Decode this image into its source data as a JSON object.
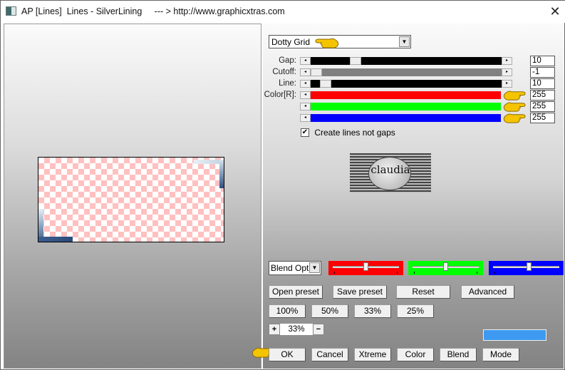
{
  "window": {
    "title": "AP [Lines]  Lines - SilverLining     --- > http://www.graphicxtras.com",
    "close_label": "✕"
  },
  "preset": {
    "selected": "Dotty Grid"
  },
  "sliders": [
    {
      "label": "Gap:",
      "value": "10",
      "position": 0.22,
      "track_color": "#000000"
    },
    {
      "label": "Cutoff:",
      "value": "-1",
      "position": 0.0,
      "track_color": "#808080"
    },
    {
      "label": "Line:",
      "value": "10",
      "position": 0.05,
      "track_color": "#000000"
    },
    {
      "label": "Color[R]:",
      "value": "255",
      "position": 1.0,
      "track_color": "#ff0000"
    },
    {
      "label": "",
      "value": "255",
      "position": 1.0,
      "track_color": "#00ff00"
    },
    {
      "label": "",
      "value": "255",
      "position": 1.0,
      "track_color": "#0000ff"
    }
  ],
  "checkbox": {
    "label": "Create lines not gaps",
    "checked": true
  },
  "logo": {
    "text": "claudia"
  },
  "blend": {
    "selected": "Blend Optio",
    "sliders": [
      {
        "color": "#ff0000",
        "position": 0.5
      },
      {
        "color": "#00ff00",
        "position": 0.5
      },
      {
        "color": "#0000ff",
        "position": 0.55
      }
    ]
  },
  "buttons": {
    "open_preset": "Open preset",
    "save_preset": "Save preset",
    "reset": "Reset",
    "advanced": "Advanced",
    "z100": "100%",
    "z50": "50%",
    "z33": "33%",
    "z25": "25%",
    "ok": "OK",
    "cancel": "Cancel",
    "xtreme": "Xtreme",
    "color": "Color",
    "blend": "Blend",
    "mode": "Mode"
  },
  "zoom": {
    "plus": "+",
    "value": "33%",
    "minus": "−"
  },
  "swatch_color": "#3d9af0"
}
